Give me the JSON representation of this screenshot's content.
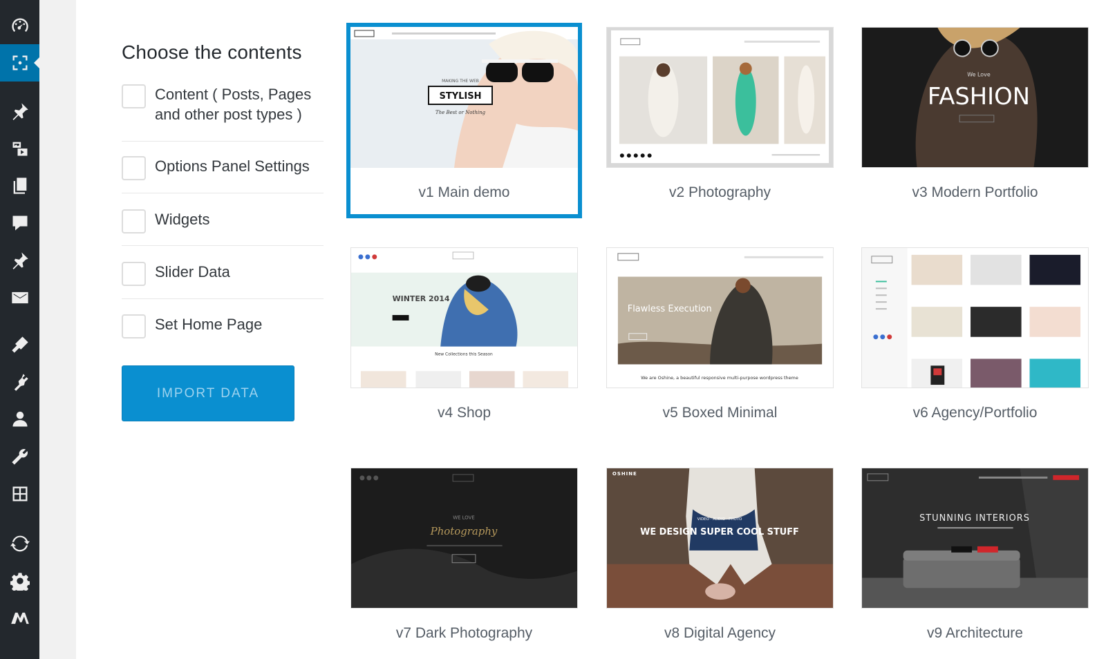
{
  "sidebar": {
    "items": [
      {
        "icon": "dashboard-icon"
      },
      {
        "icon": "screen-focus-icon",
        "active": true
      },
      {
        "icon": "pin-icon"
      },
      {
        "icon": "media-icon"
      },
      {
        "icon": "pages-icon"
      },
      {
        "icon": "comments-icon"
      },
      {
        "icon": "pin-icon"
      },
      {
        "icon": "mail-icon"
      },
      {
        "icon": "appearance-icon"
      },
      {
        "icon": "plugins-icon"
      },
      {
        "icon": "users-icon"
      },
      {
        "icon": "tools-icon"
      },
      {
        "icon": "settings-grid-icon"
      },
      {
        "icon": "refresh-icon"
      },
      {
        "icon": "gear-icon"
      },
      {
        "icon": "m-logo-icon"
      }
    ],
    "accent": "#0073aa"
  },
  "panel": {
    "title": "Choose the contents",
    "options": [
      {
        "label": "Content ( Posts, Pages and other post types )"
      },
      {
        "label": "Options Panel Settings"
      },
      {
        "label": "Widgets"
      },
      {
        "label": "Slider Data"
      },
      {
        "label": "Set Home Page"
      }
    ],
    "import_label": "IMPORT DATA"
  },
  "demos": [
    {
      "label": "v1 Main demo",
      "selected": true,
      "thumb_text": [
        "STYLISH",
        "MAKING THE WEB",
        "The Best or Nothing"
      ]
    },
    {
      "label": "v2 Photography",
      "selected": false
    },
    {
      "label": "v3 Modern Portfolio",
      "selected": false,
      "thumb_text": [
        "FASHION",
        "We Love"
      ]
    },
    {
      "label": "v4 Shop",
      "selected": false,
      "thumb_text": [
        "WINTER 2014",
        "New Collections this Season"
      ]
    },
    {
      "label": "v5 Boxed Minimal",
      "selected": false,
      "thumb_text": [
        "Flawless Execution",
        "We are Oshine, a beautiful responsive multi-purpose wordpress theme"
      ]
    },
    {
      "label": "v6 Agency/Portfolio",
      "selected": false
    },
    {
      "label": "v7 Dark Photography",
      "selected": false,
      "thumb_text": [
        "WE LOVE",
        "Photography"
      ]
    },
    {
      "label": "v8 Digital Agency",
      "selected": false,
      "thumb_text": [
        "OSHINE",
        "WE DESIGN SUPER COOL STUFF",
        "VIDEO · AUDIO · PHOTO"
      ]
    },
    {
      "label": "v9 Architecture",
      "selected": false,
      "thumb_text": [
        "STUNNING INTERIORS"
      ]
    }
  ],
  "colors": {
    "selected_border": "#0a8fd0",
    "button": "#0a8fd0",
    "sidebar": "#23282d"
  }
}
